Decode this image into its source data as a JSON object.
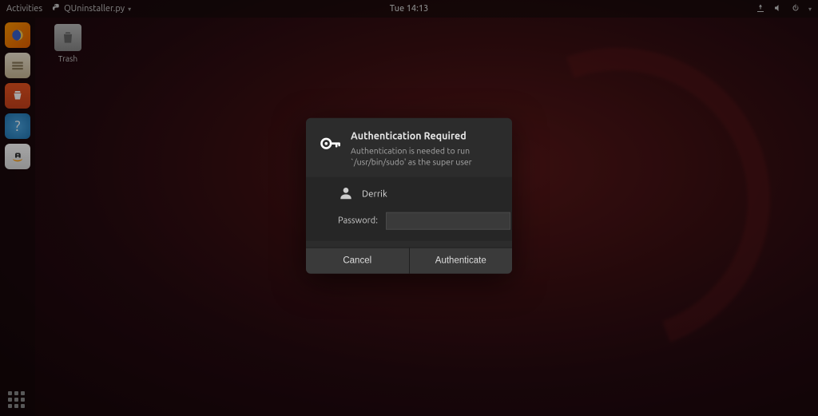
{
  "topbar": {
    "activities": "Activities",
    "app_name": "QUninstaller.py",
    "clock": "Tue 14:13"
  },
  "desktop": {
    "trash_label": "Trash"
  },
  "dialog": {
    "title": "Authentication Required",
    "message": "Authentication is needed to run `/usr/bin/sudo' as the super user",
    "user_name": "Derrik",
    "password_label": "Password:",
    "password_value": "",
    "cancel_label": "Cancel",
    "authenticate_label": "Authenticate"
  }
}
